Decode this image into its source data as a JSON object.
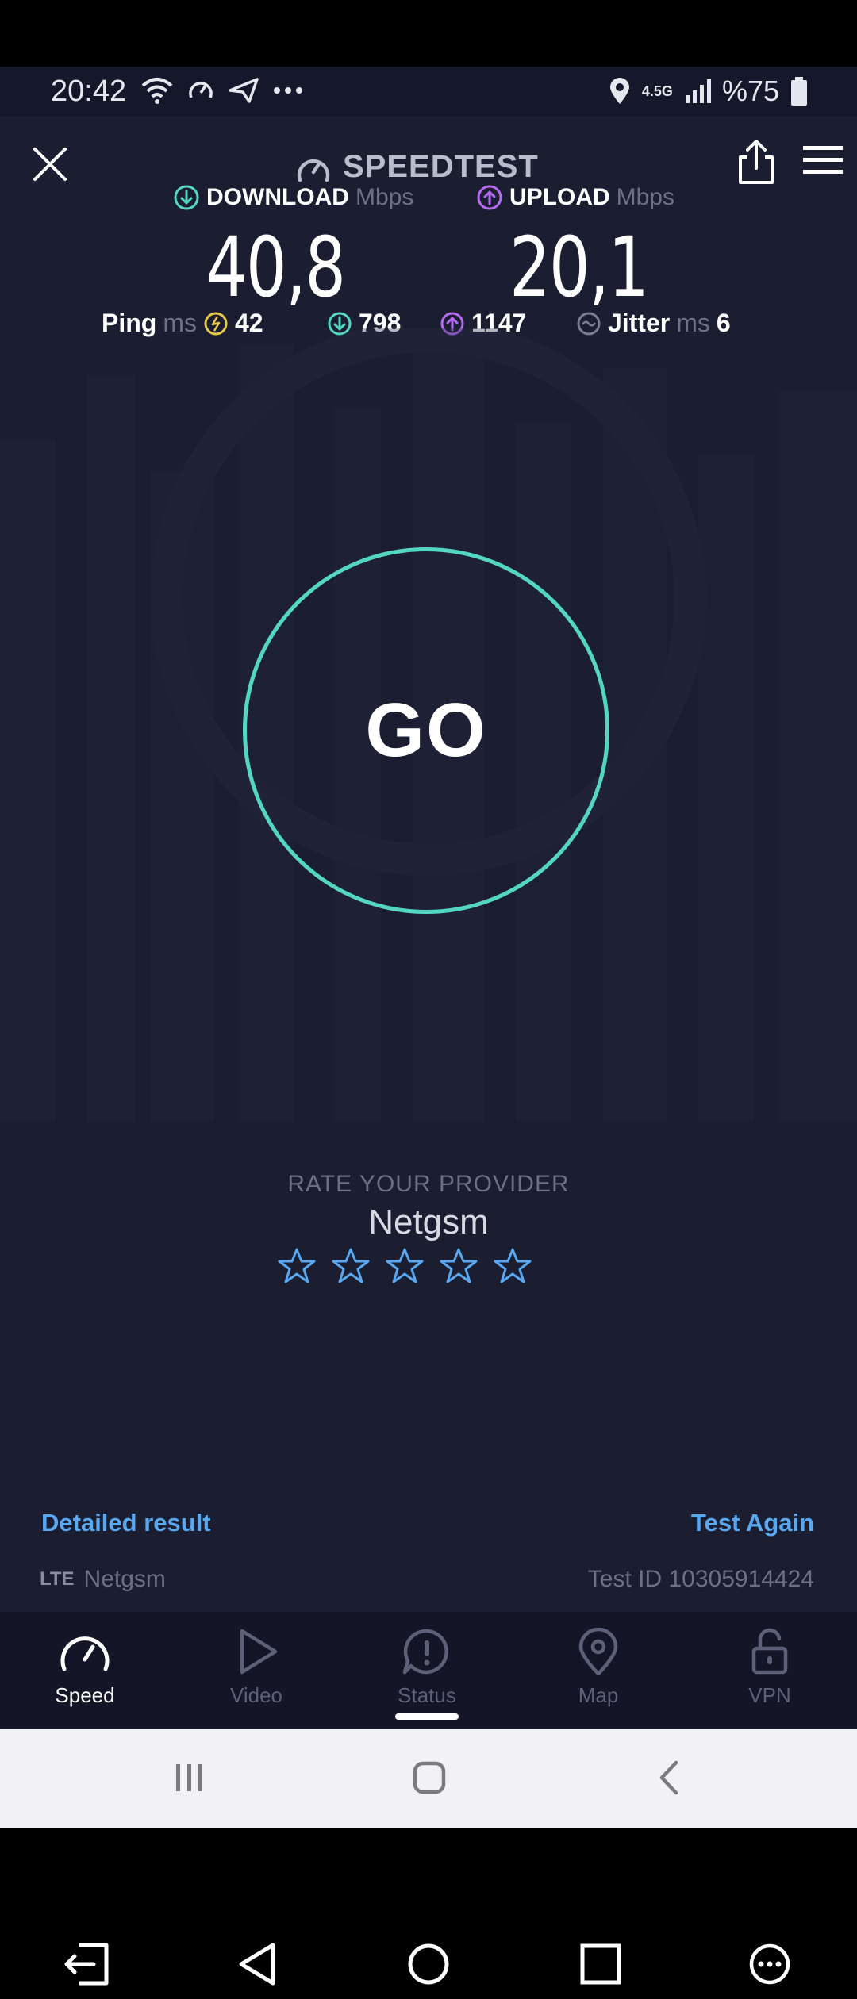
{
  "status_bar": {
    "time": "20:42",
    "network": "4.5G",
    "battery": "%75",
    "icons": [
      "wifi-icon",
      "speedtest-icon",
      "send-icon",
      "more-dots-icon",
      "location-icon",
      "signal-icon",
      "battery-icon"
    ]
  },
  "header": {
    "title": "SPEEDTEST",
    "icons": [
      "close-icon",
      "speedtest-logo-icon",
      "share-icon",
      "menu-icon"
    ]
  },
  "results": {
    "download": {
      "label": "DOWNLOAD",
      "unit": "Mbps",
      "value": "40,8",
      "color": "#53d6c2"
    },
    "upload": {
      "label": "UPLOAD",
      "unit": "Mbps",
      "value": "20,1",
      "color": "#b46bf2"
    },
    "ping": {
      "label": "Ping",
      "unit": "ms",
      "value": "42"
    },
    "download_latency": {
      "value": "798"
    },
    "upload_latency": {
      "value": "1147"
    },
    "jitter": {
      "label": "Jitter",
      "unit": "ms",
      "value": "6"
    }
  },
  "go_button": {
    "label": "GO",
    "ring_color": "#53d6c2"
  },
  "rating": {
    "title": "RATE YOUR PROVIDER",
    "provider": "Netgsm",
    "stars_total": 5,
    "stars_selected": 0
  },
  "footer": {
    "detailed_result": "Detailed result",
    "test_again": "Test Again",
    "connection_type": "LTE",
    "provider": "Netgsm",
    "test_id": "Test ID 10305914424"
  },
  "bottom_nav": {
    "items": [
      {
        "label": "Speed",
        "icon": "speed-icon",
        "active": true
      },
      {
        "label": "Video",
        "icon": "play-icon",
        "active": false
      },
      {
        "label": "Status",
        "icon": "alert-icon",
        "active": false
      },
      {
        "label": "Map",
        "icon": "map-pin-icon",
        "active": false
      },
      {
        "label": "VPN",
        "icon": "lock-icon",
        "active": false
      }
    ]
  },
  "colors": {
    "background": "#1b1d30",
    "accent_link": "#5aa8ef",
    "download": "#53d6c2",
    "upload": "#b46bf2",
    "ping": "#e6c84a"
  }
}
